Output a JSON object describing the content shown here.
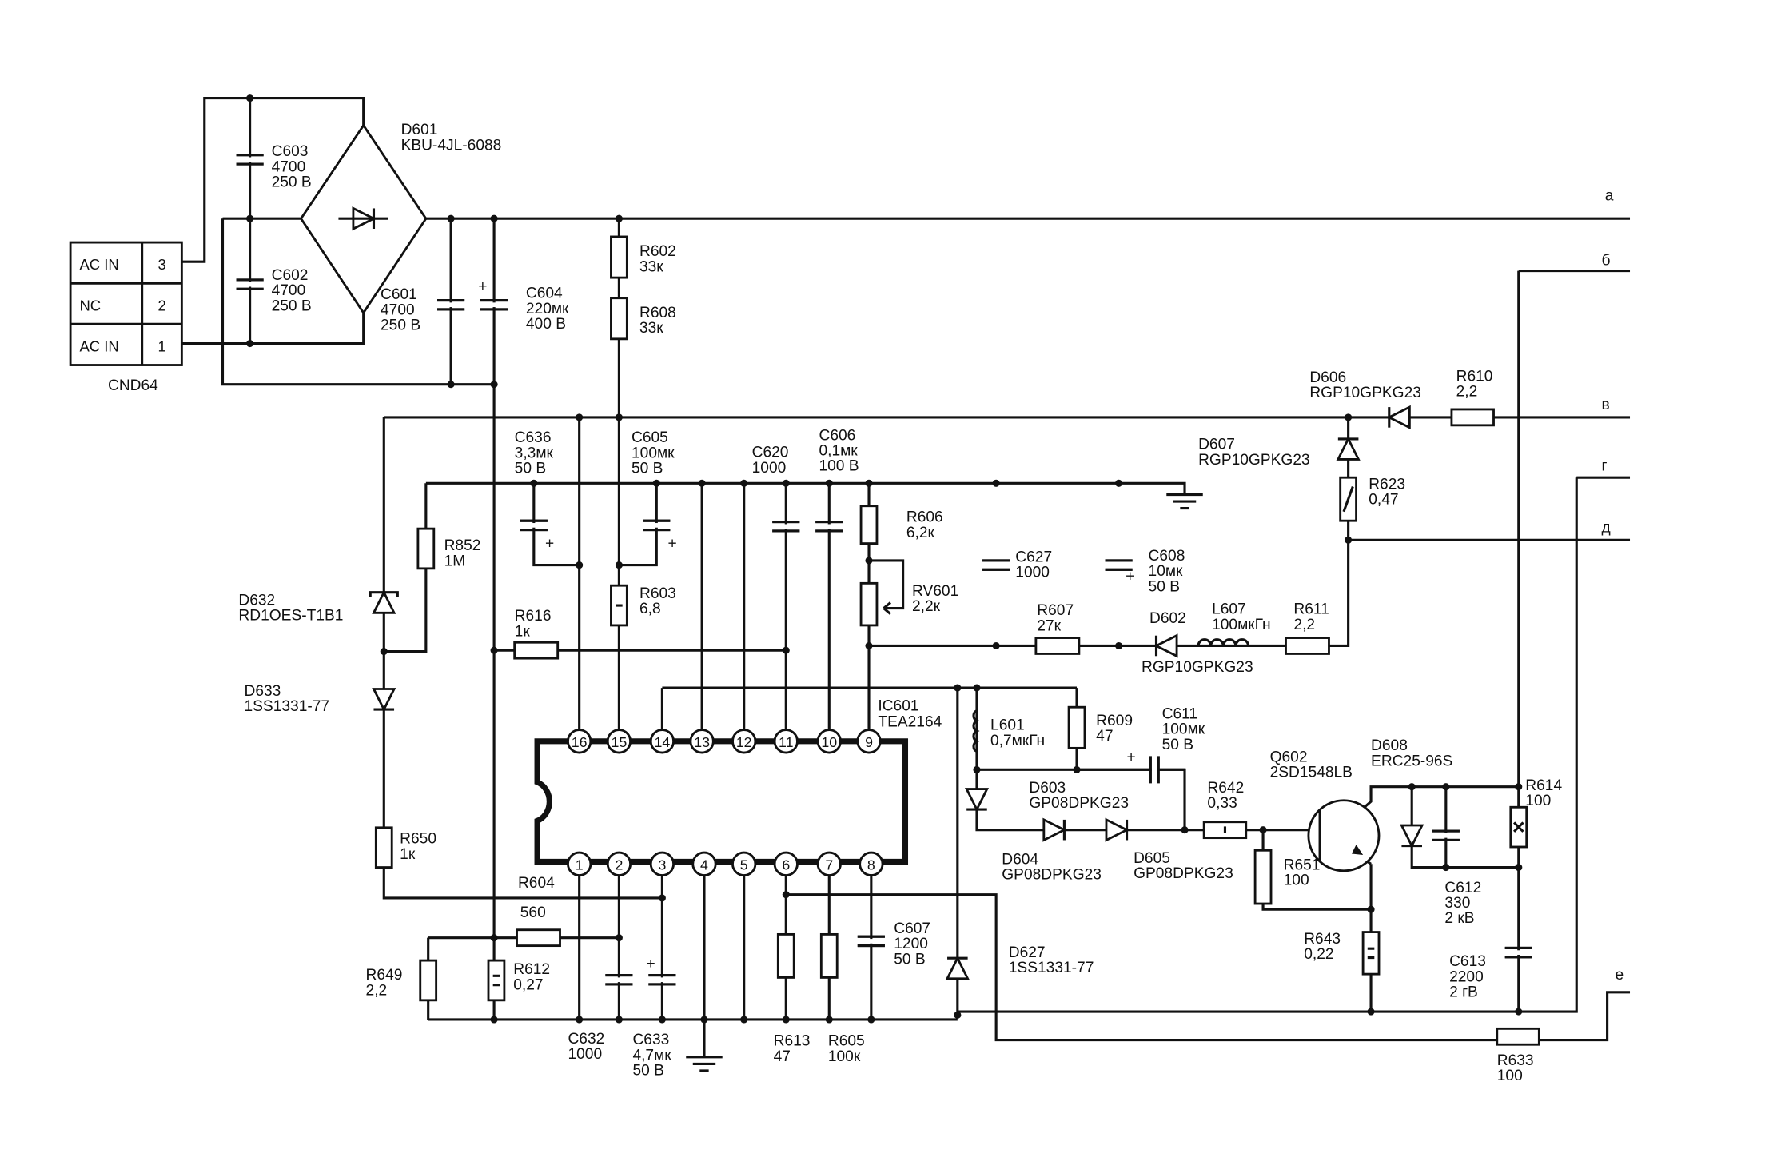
{
  "connector": {
    "name": "CND64",
    "rows": [
      {
        "label": "AC IN",
        "pin": "3"
      },
      {
        "label": "NC",
        "pin": "2"
      },
      {
        "label": "AC IN",
        "pin": "1"
      }
    ]
  },
  "nets": {
    "a": "а",
    "b": "б",
    "v": "в",
    "g": "г",
    "d": "д",
    "e": "е"
  },
  "ic": {
    "ref": "IC601",
    "part": "TEA2164",
    "top_pins": [
      "16",
      "15",
      "14",
      "13",
      "12",
      "11",
      "10",
      "9"
    ],
    "bottom_pins": [
      "1",
      "2",
      "3",
      "4",
      "5",
      "6",
      "7",
      "8"
    ]
  },
  "components": [
    {
      "ref": "D601",
      "lines": [
        "KBU-4JL-6088"
      ]
    },
    {
      "ref": "C603",
      "lines": [
        "4700",
        "250 В"
      ]
    },
    {
      "ref": "C602",
      "lines": [
        "4700",
        "250 В"
      ]
    },
    {
      "ref": "C601",
      "lines": [
        "4700",
        "250 В"
      ]
    },
    {
      "ref": "C604",
      "lines": [
        "220мк",
        "400 В"
      ]
    },
    {
      "ref": "R602",
      "lines": [
        "33к"
      ]
    },
    {
      "ref": "R608",
      "lines": [
        "33к"
      ]
    },
    {
      "ref": "C636",
      "lines": [
        "3,3мк",
        "50 В"
      ]
    },
    {
      "ref": "C605",
      "lines": [
        "100мк",
        "50 В"
      ]
    },
    {
      "ref": "C620",
      "lines": [
        "1000"
      ]
    },
    {
      "ref": "C606",
      "lines": [
        "0,1мк",
        "100 В"
      ]
    },
    {
      "ref": "R606",
      "lines": [
        "6,2к"
      ]
    },
    {
      "ref": "RV601",
      "lines": [
        "2,2к"
      ]
    },
    {
      "ref": "C627",
      "lines": [
        "1000"
      ]
    },
    {
      "ref": "C608",
      "lines": [
        "10мк",
        "50 В"
      ]
    },
    {
      "ref": "R607",
      "lines": [
        "27к"
      ]
    },
    {
      "ref": "D602",
      "lines": [
        "RGP10GPKG23"
      ]
    },
    {
      "ref": "L607",
      "lines": [
        "100мкГн"
      ]
    },
    {
      "ref": "R611",
      "lines": [
        "2,2"
      ]
    },
    {
      "ref": "D606",
      "lines": [
        "RGP10GPKG23"
      ]
    },
    {
      "ref": "R610",
      "lines": [
        "2,2"
      ]
    },
    {
      "ref": "D607",
      "lines": [
        "RGP10GPKG23"
      ]
    },
    {
      "ref": "R623",
      "lines": [
        "0,47"
      ]
    },
    {
      "ref": "R852",
      "lines": [
        "1M"
      ]
    },
    {
      "ref": "D632",
      "lines": [
        "RD1OES-T1B1"
      ]
    },
    {
      "ref": "D633",
      "lines": [
        "1SS1331-77"
      ]
    },
    {
      "ref": "R616",
      "lines": [
        "1к"
      ]
    },
    {
      "ref": "R603",
      "lines": [
        "6,8"
      ]
    },
    {
      "ref": "R650",
      "lines": [
        "1к"
      ]
    },
    {
      "ref": "R604",
      "lines": [
        "560"
      ]
    },
    {
      "ref": "R649",
      "lines": [
        "2,2"
      ]
    },
    {
      "ref": "R612",
      "lines": [
        "0,27"
      ]
    },
    {
      "ref": "C632",
      "lines": [
        "1000"
      ]
    },
    {
      "ref": "C633",
      "lines": [
        "4,7мк",
        "50 В"
      ]
    },
    {
      "ref": "R613",
      "lines": [
        "47"
      ]
    },
    {
      "ref": "R605",
      "lines": [
        "100к"
      ]
    },
    {
      "ref": "C607",
      "lines": [
        "1200",
        "50 В"
      ]
    },
    {
      "ref": "D627",
      "lines": [
        "1SS1331-77"
      ]
    },
    {
      "ref": "L601",
      "lines": [
        "0,7мкГн"
      ]
    },
    {
      "ref": "R609",
      "lines": [
        "47"
      ]
    },
    {
      "ref": "C611",
      "lines": [
        "100мк",
        "50 В"
      ]
    },
    {
      "ref": "D603",
      "lines": [
        "GP08DPKG23"
      ]
    },
    {
      "ref": "D604",
      "lines": [
        "GP08DPKG23"
      ]
    },
    {
      "ref": "D605",
      "lines": [
        "GP08DPKG23"
      ]
    },
    {
      "ref": "R642",
      "lines": [
        "0,33"
      ]
    },
    {
      "ref": "Q602",
      "lines": [
        "2SD1548LB"
      ]
    },
    {
      "ref": "D608",
      "lines": [
        "ERC25-96S"
      ]
    },
    {
      "ref": "R651",
      "lines": [
        "100"
      ]
    },
    {
      "ref": "R643",
      "lines": [
        "0,22"
      ]
    },
    {
      "ref": "R614",
      "lines": [
        "100"
      ]
    },
    {
      "ref": "C612",
      "lines": [
        "330",
        "2 кВ"
      ]
    },
    {
      "ref": "C613",
      "lines": [
        "2200",
        "2 гВ"
      ]
    },
    {
      "ref": "R633",
      "lines": [
        "100"
      ]
    }
  ]
}
